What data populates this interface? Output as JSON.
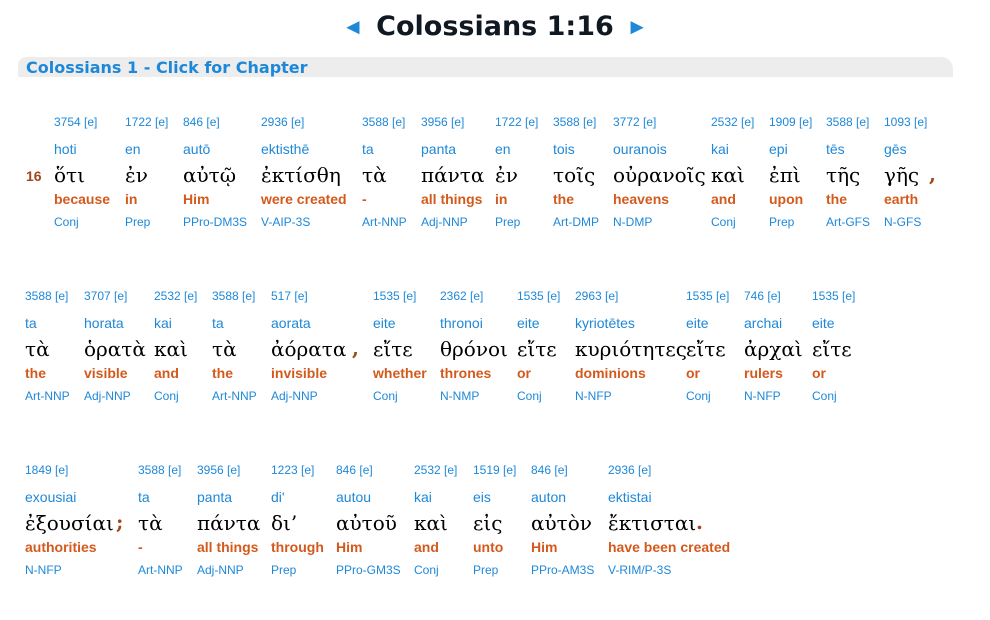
{
  "header": {
    "prev_icon": "◄",
    "title": "Colossians 1:16",
    "next_icon": "►"
  },
  "chapter_link": "Colossians 1 - Click for Chapter",
  "verse_number": "16",
  "colors": {
    "link_blue": "#1e88d8",
    "english_orange": "#d35a1c",
    "verse_brown": "#a0461b",
    "bar_gray": "#ededed"
  },
  "rows": [
    {
      "words": [
        {
          "strong": "3754 [e]",
          "translit": "hoti",
          "greek": "ὅτι",
          "english": "because",
          "parse": "Conj"
        },
        {
          "strong": "1722 [e]",
          "translit": "en",
          "greek": "ἐν",
          "english": "in",
          "parse": "Prep"
        },
        {
          "strong": "846 [e]",
          "translit": "autō",
          "greek": "αὐτῷ",
          "english": "Him",
          "parse": "PPro-DM3S"
        },
        {
          "strong": "2936 [e]",
          "translit": "ektisthē",
          "greek": "ἐκτίσθη",
          "english": "were created",
          "parse": "V-AIP-3S"
        },
        {
          "strong": "3588 [e]",
          "translit": "ta",
          "greek": "τὰ",
          "english": "-",
          "parse": "Art-NNP"
        },
        {
          "strong": "3956 [e]",
          "translit": "panta",
          "greek": "πάντα",
          "english": "all things",
          "parse": "Adj-NNP"
        },
        {
          "strong": "1722 [e]",
          "translit": "en",
          "greek": "ἐν",
          "english": "in",
          "parse": "Prep"
        },
        {
          "strong": "3588 [e]",
          "translit": "tois",
          "greek": "τοῖς",
          "english": "the",
          "parse": "Art-DMP"
        },
        {
          "strong": "3772 [e]",
          "translit": "ouranois",
          "greek": "οὐρανοῖς",
          "english": "heavens",
          "parse": "N-DMP"
        },
        {
          "strong": "2532 [e]",
          "translit": "kai",
          "greek": "καὶ",
          "english": "and",
          "parse": "Conj"
        },
        {
          "strong": "1909 [e]",
          "translit": "epi",
          "greek": "ἐπὶ",
          "english": "upon",
          "parse": "Prep"
        },
        {
          "strong": "3588 [e]",
          "translit": "tēs",
          "greek": "τῆς",
          "english": "the",
          "parse": "Art-GFS"
        },
        {
          "strong": "1093 [e]",
          "translit": "gēs",
          "greek": "γῆς",
          "english": "earth",
          "parse": "N-GFS"
        }
      ],
      "punct": ","
    },
    {
      "words": [
        {
          "strong": "3588 [e]",
          "translit": "ta",
          "greek": "τὰ",
          "english": "the",
          "parse": "Art-NNP"
        },
        {
          "strong": "3707 [e]",
          "translit": "horata",
          "greek": "ὁρατὰ",
          "english": "visible",
          "parse": "Adj-NNP"
        },
        {
          "strong": "2532 [e]",
          "translit": "kai",
          "greek": "καὶ",
          "english": "and",
          "parse": "Conj"
        },
        {
          "strong": "3588 [e]",
          "translit": "ta",
          "greek": "τὰ",
          "english": "the",
          "parse": "Art-NNP"
        },
        {
          "strong": "517 [e]",
          "translit": "aorata",
          "greek": "ἀόρατα",
          "english": "invisible",
          "parse": "Adj-NNP"
        },
        {
          "strong": "1535 [e]",
          "translit": "eite",
          "greek": "εἴτε",
          "english": "whether",
          "parse": "Conj"
        },
        {
          "strong": "2362 [e]",
          "translit": "thronoi",
          "greek": "θρόνοι",
          "english": "thrones",
          "parse": "N-NMP"
        },
        {
          "strong": "1535 [e]",
          "translit": "eite",
          "greek": "εἴτε",
          "english": "or",
          "parse": "Conj"
        },
        {
          "strong": "2963 [e]",
          "translit": "kyriotētes",
          "greek": "κυριότητες",
          "english": "dominions",
          "parse": "N-NFP"
        },
        {
          "strong": "1535 [e]",
          "translit": "eite",
          "greek": "εἴτε",
          "english": "or",
          "parse": "Conj"
        },
        {
          "strong": "746 [e]",
          "translit": "archai",
          "greek": "ἀρχαὶ",
          "english": "rulers",
          "parse": "N-NFP"
        },
        {
          "strong": "1535 [e]",
          "translit": "eite",
          "greek": "εἴτε",
          "english": "or",
          "parse": "Conj"
        }
      ],
      "punct": ","
    },
    {
      "words": [
        {
          "strong": "1849 [e]",
          "translit": "exousiai",
          "greek": "ἐξουσίαι",
          "english": "authorities",
          "parse": "N-NFP"
        },
        {
          "strong": "3588 [e]",
          "translit": "ta",
          "greek": "τὰ",
          "english": "-",
          "parse": "Art-NNP"
        },
        {
          "strong": "3956 [e]",
          "translit": "panta",
          "greek": "πάντα",
          "english": "all things",
          "parse": "Adj-NNP"
        },
        {
          "strong": "1223 [e]",
          "translit": "di'",
          "greek": "δι’",
          "english": "through",
          "parse": "Prep"
        },
        {
          "strong": "846 [e]",
          "translit": "autou",
          "greek": "αὐτοῦ",
          "english": "Him",
          "parse": "PPro-GM3S"
        },
        {
          "strong": "2532 [e]",
          "translit": "kai",
          "greek": "καὶ",
          "english": "and",
          "parse": "Conj"
        },
        {
          "strong": "1519 [e]",
          "translit": "eis",
          "greek": "εἰς",
          "english": "unto",
          "parse": "Prep"
        },
        {
          "strong": "846 [e]",
          "translit": "auton",
          "greek": "αὐτὸν",
          "english": "Him",
          "parse": "PPro-AM3S"
        },
        {
          "strong": "2936 [e]",
          "translit": "ektistai",
          "greek": "ἔκτισται",
          "english": "have been created",
          "parse": "V-RIM/P-3S"
        }
      ],
      "punct_semicolon": ";",
      "punct": "."
    }
  ]
}
